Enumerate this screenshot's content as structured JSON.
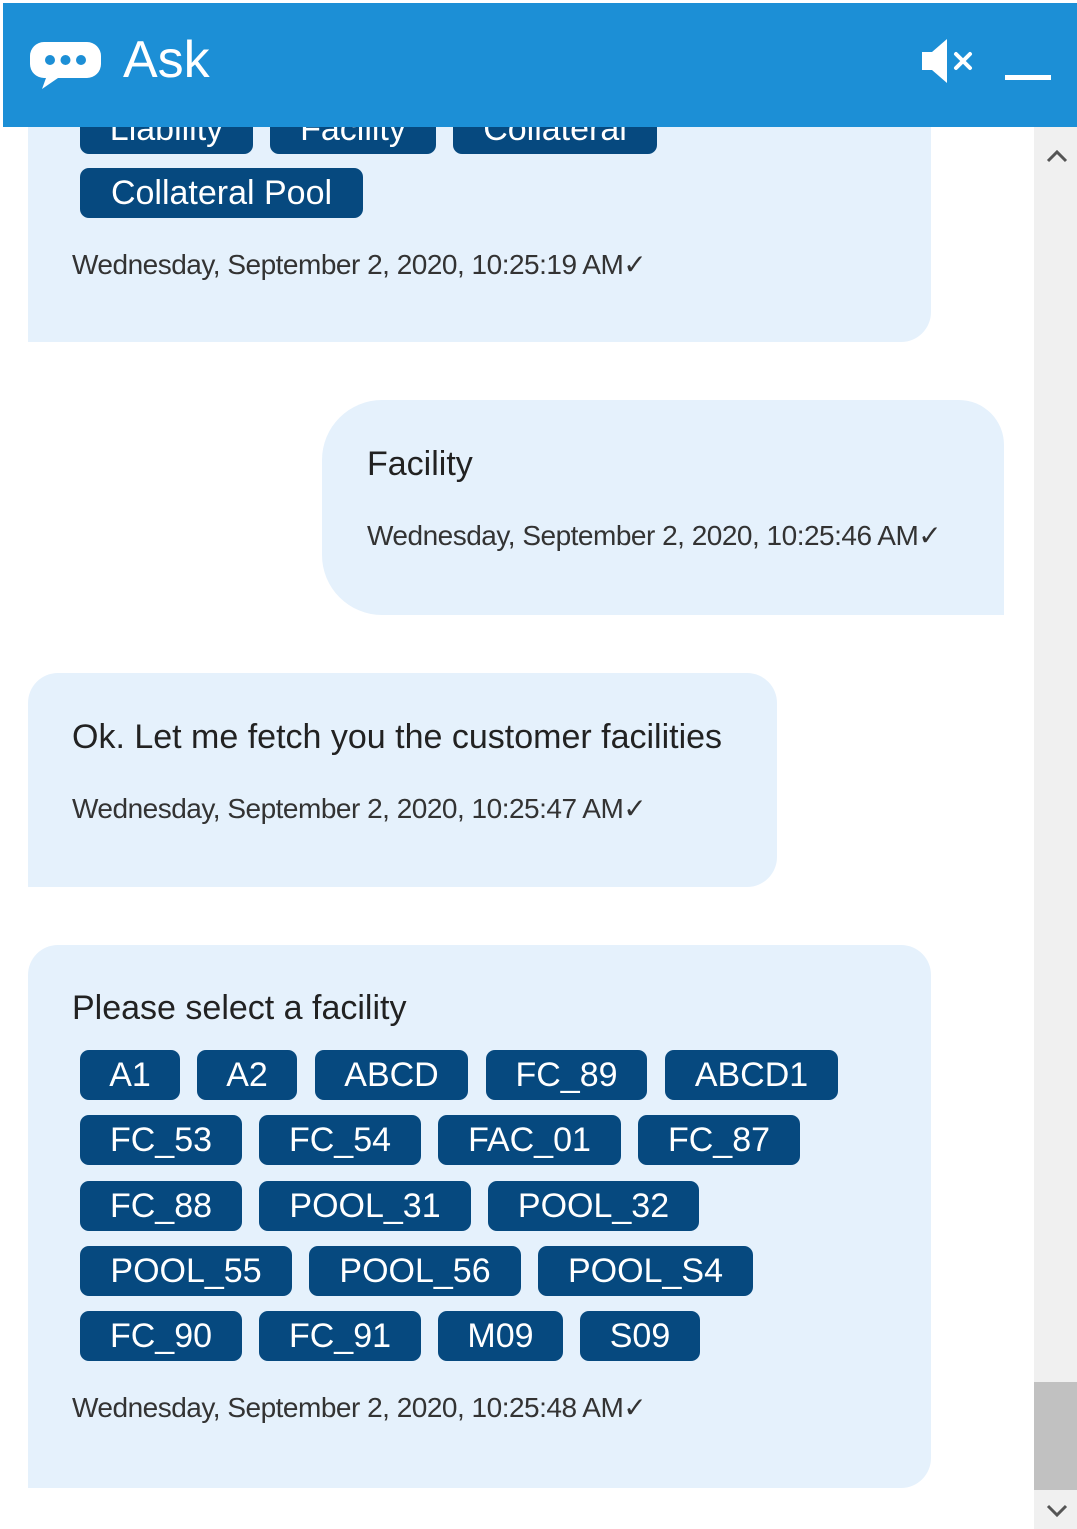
{
  "header": {
    "title": "Ask",
    "accent_color": "#1c8fd6",
    "icons": [
      "chat-bubble-icon",
      "speaker-muted-icon",
      "minimize-icon"
    ]
  },
  "messages": [
    {
      "sender": "bot",
      "chips": [
        "Liability",
        "Facility",
        "Collateral",
        "Collateral Pool"
      ],
      "time": "Wednesday, September 2, 2020, 10:25:19 AM✓"
    },
    {
      "sender": "user",
      "text": "Facility",
      "time": "Wednesday, September 2, 2020, 10:25:46 AM✓"
    },
    {
      "sender": "bot",
      "text": "Ok. Let me fetch you the customer facilities",
      "time": "Wednesday, September 2, 2020, 10:25:47 AM✓"
    },
    {
      "sender": "bot",
      "text": "Please select a facility",
      "chips": [
        "A1",
        "A2",
        "ABCD",
        "FC_89",
        "ABCD1",
        "FC_53",
        "FC_54",
        "FAC_01",
        "FC_87",
        "FC_88",
        "POOL_31",
        "POOL_32",
        "POOL_55",
        "POOL_56",
        "POOL_S4",
        "FC_90",
        "FC_91",
        "M09",
        "S09"
      ],
      "time": "Wednesday, September 2, 2020, 10:25:48 AM✓"
    }
  ],
  "colors": {
    "bubble": "#e5f1fc",
    "chip": "#06497f",
    "chip_text": "#ffffff"
  }
}
